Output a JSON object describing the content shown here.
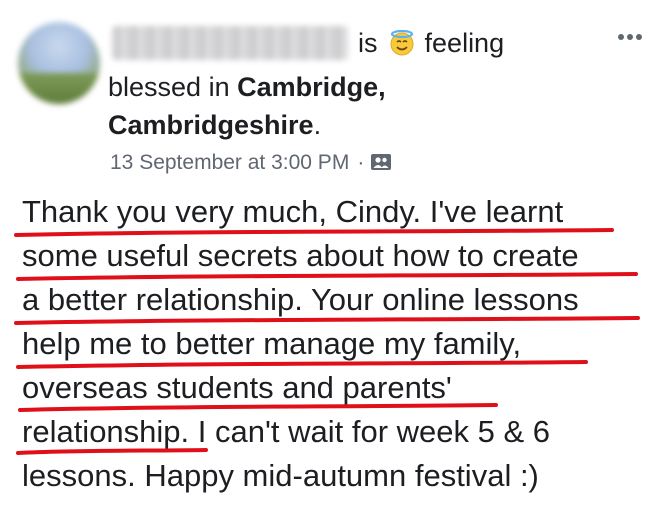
{
  "post": {
    "author_name_redacted": "",
    "activity_prefix": "is",
    "activity_emoji": "halo-smiling-face-emoji",
    "activity_feeling": "feeling",
    "activity_state": "blessed in",
    "location_part1": "Cambridge,",
    "location_part2": "Cambridgeshire",
    "location_end": ".",
    "timestamp": "13 September at 3:00 PM",
    "separator": "·",
    "audience_icon": "friends-audience-icon",
    "more_label": "•••",
    "body_lines": [
      "Thank you very much, Cindy. I've learnt",
      "some useful secrets about how to create",
      "a better relationship. Your online lessons",
      "help me to better manage my family,",
      "overseas students and parents'",
      "relationship. I can't wait for week 5 & 6",
      "lessons.  Happy mid-autumn festival :)"
    ]
  },
  "colors": {
    "text": "#1c1e21",
    "meta": "#606770",
    "underline": "#e0101a",
    "more": "#606770"
  }
}
